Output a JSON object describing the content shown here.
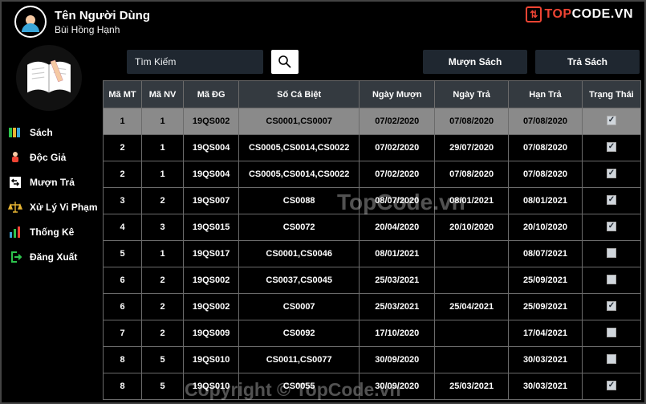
{
  "header": {
    "user_title": "Tên Người Dùng",
    "user_name": "Bùi Hồng Hạnh"
  },
  "logo": {
    "badge": "↑↓",
    "text": "TOPCODE.VN"
  },
  "sidebar": {
    "items": [
      {
        "label": "Sách"
      },
      {
        "label": "Độc Giả"
      },
      {
        "label": "Mượn Trả"
      },
      {
        "label": "Xử Lý Vi Phạm"
      },
      {
        "label": "Thống Kê"
      },
      {
        "label": "Đăng Xuất"
      }
    ]
  },
  "toolbar": {
    "search_placeholder": "Tìm Kiếm",
    "borrow_label": "Mượn Sách",
    "return_label": "Trả Sách"
  },
  "table": {
    "headers": [
      "Mã MT",
      "Mã NV",
      "Mã ĐG",
      "Số Cá Biệt",
      "Ngày Mượn",
      "Ngày Trả",
      "Hạn Trả",
      "Trạng Thái"
    ],
    "rows": [
      {
        "mt": "1",
        "nv": "1",
        "dg": "19QS002",
        "cb": "CS0001,CS0007",
        "nm": "07/02/2020",
        "nt": "07/08/2020",
        "ht": "07/08/2020",
        "checked": true,
        "selected": true
      },
      {
        "mt": "2",
        "nv": "1",
        "dg": "19QS004",
        "cb": "CS0005,CS0014,CS0022",
        "nm": "07/02/2020",
        "nt": "29/07/2020",
        "ht": "07/08/2020",
        "checked": true
      },
      {
        "mt": "2",
        "nv": "1",
        "dg": "19QS004",
        "cb": "CS0005,CS0014,CS0022",
        "nm": "07/02/2020",
        "nt": "07/08/2020",
        "ht": "07/08/2020",
        "checked": true
      },
      {
        "mt": "3",
        "nv": "2",
        "dg": "19QS007",
        "cb": "CS0088",
        "nm": "08/07/2020",
        "nt": "08/01/2021",
        "ht": "08/01/2021",
        "checked": true
      },
      {
        "mt": "4",
        "nv": "3",
        "dg": "19QS015",
        "cb": "CS0072",
        "nm": "20/04/2020",
        "nt": "20/10/2020",
        "ht": "20/10/2020",
        "checked": true
      },
      {
        "mt": "5",
        "nv": "1",
        "dg": "19QS017",
        "cb": "CS0001,CS0046",
        "nm": "08/01/2021",
        "nt": "",
        "ht": "08/07/2021",
        "checked": false
      },
      {
        "mt": "6",
        "nv": "2",
        "dg": "19QS002",
        "cb": "CS0037,CS0045",
        "nm": "25/03/2021",
        "nt": "",
        "ht": "25/09/2021",
        "checked": false
      },
      {
        "mt": "6",
        "nv": "2",
        "dg": "19QS002",
        "cb": "CS0007",
        "nm": "25/03/2021",
        "nt": "25/04/2021",
        "ht": "25/09/2021",
        "checked": true
      },
      {
        "mt": "7",
        "nv": "2",
        "dg": "19QS009",
        "cb": "CS0092",
        "nm": "17/10/2020",
        "nt": "",
        "ht": "17/04/2021",
        "checked": false
      },
      {
        "mt": "8",
        "nv": "5",
        "dg": "19QS010",
        "cb": "CS0011,CS0077",
        "nm": "30/09/2020",
        "nt": "",
        "ht": "30/03/2021",
        "checked": false
      },
      {
        "mt": "8",
        "nv": "5",
        "dg": "19QS010",
        "cb": "CS0055",
        "nm": "30/09/2020",
        "nt": "25/03/2021",
        "ht": "30/03/2021",
        "checked": true
      }
    ]
  },
  "watermark": {
    "brand": "TopCode.vn",
    "copyright": "Copyright © TopCode.vn"
  }
}
